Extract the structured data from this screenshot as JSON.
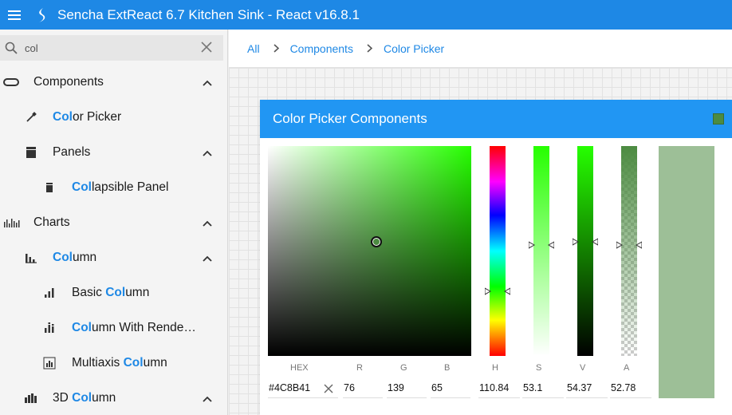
{
  "app": {
    "title": "Sencha ExtReact 6.7 Kitchen Sink - React v16.8.1",
    "menu_icon": "hamburger-icon",
    "logo_icon": "sencha-logo-icon"
  },
  "search": {
    "value": "col",
    "placeholder": ""
  },
  "tree": [
    {
      "pre": "",
      "hl": "",
      "post": "Components",
      "icon": "components-icon",
      "expanded": true
    },
    {
      "pre": "",
      "hl": "Col",
      "post": "or Picker",
      "icon": "eyedropper-icon"
    },
    {
      "pre": "",
      "hl": "",
      "post": "Panels",
      "icon": "panels-icon",
      "expanded": true
    },
    {
      "pre": "",
      "hl": "Col",
      "post": "lapsible Panel",
      "icon": "collapsible-panel-icon"
    },
    {
      "pre": "",
      "hl": "",
      "post": "Charts",
      "icon": "charts-icon",
      "expanded": true
    },
    {
      "pre": "",
      "hl": "Col",
      "post": "umn",
      "icon": "column-chart-icon",
      "expanded": true
    },
    {
      "pre": "Basic ",
      "hl": "Col",
      "post": "umn",
      "icon": "basic-column-icon"
    },
    {
      "pre": "",
      "hl": "Col",
      "post": "umn With Rende…",
      "icon": "column-renderer-icon"
    },
    {
      "pre": "Multiaxis ",
      "hl": "Col",
      "post": "umn",
      "icon": "multiaxis-column-icon"
    },
    {
      "pre": "3D ",
      "hl": "Col",
      "post": "umn",
      "icon": "3d-column-icon",
      "expanded": true
    }
  ],
  "breadcrumb": [
    "All",
    "Components",
    "Color Picker"
  ],
  "panel": {
    "title": "Color Picker Components",
    "color": "#4C8B41"
  },
  "picker": {
    "labels": {
      "hex": "HEX",
      "r": "R",
      "g": "G",
      "b": "B",
      "h": "H",
      "s": "S",
      "v": "V",
      "a": "A"
    },
    "values": {
      "hex": "#4C8B41",
      "r": "76",
      "g": "139",
      "b": "65",
      "h": "110.84",
      "s": "53.1",
      "v": "54.37",
      "a": "52.78"
    }
  }
}
